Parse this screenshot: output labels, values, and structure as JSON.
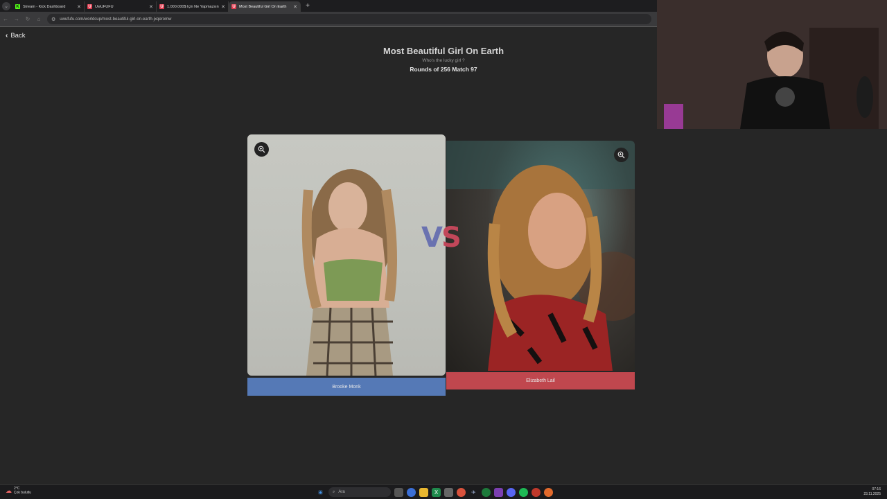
{
  "browser": {
    "tabs": [
      {
        "label": "Stream - Kick Dashboard",
        "favicon": "K",
        "favicon_color": "#53fc18",
        "active": false
      },
      {
        "label": "UwUFUFU",
        "favicon": "U",
        "favicon_color": "#e03a4e",
        "active": false
      },
      {
        "label": "1.000.000$ İçin Ne Yapmazsın!",
        "favicon": "U",
        "favicon_color": "#e03a4e",
        "active": false
      },
      {
        "label": "Most Beautiful Girl On Earth",
        "favicon": "U",
        "favicon_color": "#e03a4e",
        "active": true
      }
    ],
    "url": "uwufufu.com/worldcup/most-beautiful-girl-on-earth-jxqeromw"
  },
  "page": {
    "back_label": "Back",
    "title": "Most Beautiful Girl On Earth",
    "subtitle": "Who's the lucky girl ?",
    "rounds": "Rounds of 256 Match 97",
    "vs_v": "V",
    "vs_s": "S"
  },
  "contestants": {
    "left": {
      "name": "Brooke Monk",
      "color": "#5579b6"
    },
    "right": {
      "name": "Elizabeth Lail",
      "color": "#c0474e"
    }
  },
  "taskbar": {
    "weather_temp": "2°C",
    "weather_desc": "Çok bulutlu",
    "search_placeholder": "Ara",
    "time": "07:16",
    "date": "23.11.2025"
  }
}
